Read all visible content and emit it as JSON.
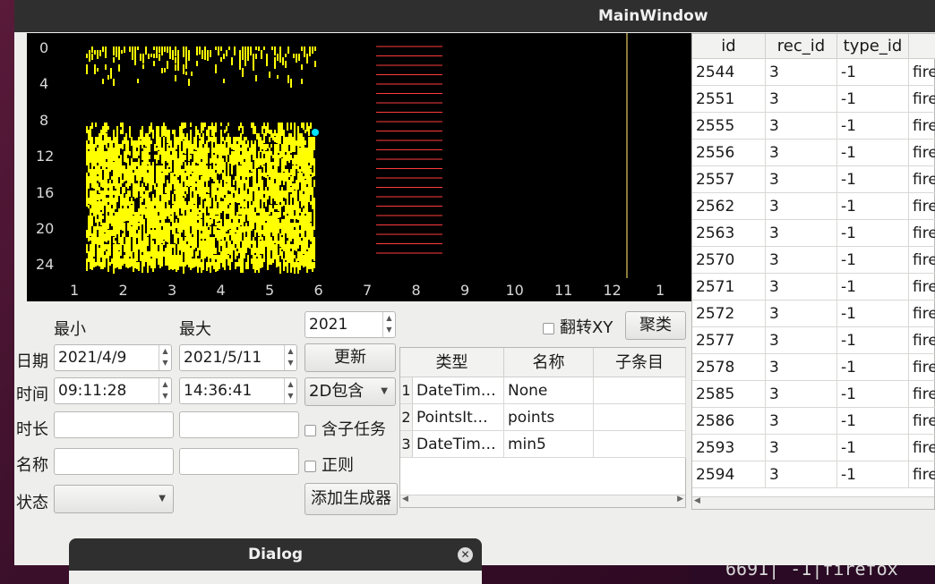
{
  "window": {
    "title": "MainWindow"
  },
  "terminal": {
    "text": "6691|  -1|firefox"
  },
  "plot": {
    "yticks": [
      "0",
      "4",
      "8",
      "12",
      "16",
      "20",
      "24"
    ],
    "xticks": [
      "1",
      "2",
      "3",
      "4",
      "5",
      "6",
      "7",
      "8",
      "9",
      "10",
      "11",
      "12",
      "1"
    ],
    "colors": {
      "background": "#000000",
      "points": "#ffff00",
      "lines": "#ff3b3b",
      "marker": "#00e5ff",
      "cursor": "#8a7a3a"
    }
  },
  "filters": {
    "min_label": "最小",
    "max_label": "最大",
    "year_value": "2021",
    "date_label": "日期",
    "date_min": "2021/4/9",
    "date_max": "2021/5/11",
    "time_label": "时间",
    "time_min": "09:11:28",
    "time_max": "14:36:41",
    "duration_label": "时长",
    "duration_min": "",
    "duration_max": "",
    "name_label": "名称",
    "name_min": "",
    "name_max": "",
    "status_label": "状态",
    "status_value": "",
    "flip_xy_label": "翻转XY",
    "cluster_button": "聚类",
    "update_button": "更新",
    "mode_value": "2D包含",
    "subtask_label": "含子任务",
    "regex_label": "正则",
    "add_generator_button": "添加生成器"
  },
  "generators": {
    "headers": [
      "类型",
      "名称",
      "子条目"
    ],
    "rows": [
      {
        "num": "1",
        "type": "DateTim…",
        "name": "None",
        "child": ""
      },
      {
        "num": "2",
        "type": "PointsIt…",
        "name": "points",
        "child": ""
      },
      {
        "num": "3",
        "type": "DateTim…",
        "name": "min5",
        "child": ""
      }
    ]
  },
  "records": {
    "headers": [
      "id",
      "rec_id",
      "type_id",
      ""
    ],
    "rows": [
      {
        "id": "2544",
        "rec_id": "3",
        "type_id": "-1",
        "name": "fire"
      },
      {
        "id": "2551",
        "rec_id": "3",
        "type_id": "-1",
        "name": "fire"
      },
      {
        "id": "2555",
        "rec_id": "3",
        "type_id": "-1",
        "name": "fire"
      },
      {
        "id": "2556",
        "rec_id": "3",
        "type_id": "-1",
        "name": "fire"
      },
      {
        "id": "2557",
        "rec_id": "3",
        "type_id": "-1",
        "name": "fire"
      },
      {
        "id": "2562",
        "rec_id": "3",
        "type_id": "-1",
        "name": "fire"
      },
      {
        "id": "2563",
        "rec_id": "3",
        "type_id": "-1",
        "name": "fire"
      },
      {
        "id": "2570",
        "rec_id": "3",
        "type_id": "-1",
        "name": "fire"
      },
      {
        "id": "2571",
        "rec_id": "3",
        "type_id": "-1",
        "name": "fire"
      },
      {
        "id": "2572",
        "rec_id": "3",
        "type_id": "-1",
        "name": "fire"
      },
      {
        "id": "2577",
        "rec_id": "3",
        "type_id": "-1",
        "name": "fire"
      },
      {
        "id": "2578",
        "rec_id": "3",
        "type_id": "-1",
        "name": "fire"
      },
      {
        "id": "2585",
        "rec_id": "3",
        "type_id": "-1",
        "name": "fire"
      },
      {
        "id": "2586",
        "rec_id": "3",
        "type_id": "-1",
        "name": "fire"
      },
      {
        "id": "2593",
        "rec_id": "3",
        "type_id": "-1",
        "name": "fire"
      },
      {
        "id": "2594",
        "rec_id": "3",
        "type_id": "-1",
        "name": "fire"
      }
    ]
  },
  "dialog": {
    "title": "Dialog"
  }
}
